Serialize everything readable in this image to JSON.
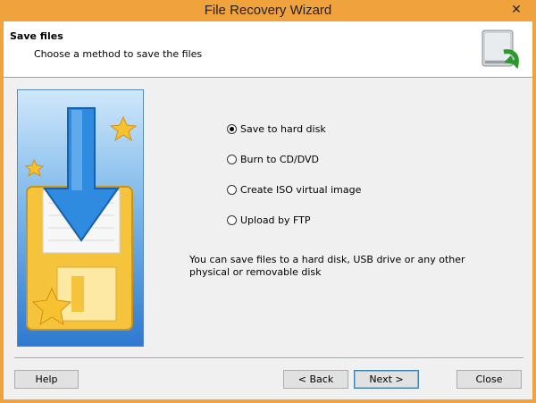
{
  "window": {
    "title": "File Recovery Wizard",
    "close_glyph": "✕"
  },
  "header": {
    "title": "Save files",
    "subtitle": "Choose a method to save the files",
    "icon": "hard-drive-recover-icon"
  },
  "options": [
    {
      "label": "Save to hard disk",
      "checked": true
    },
    {
      "label": "Burn to CD/DVD",
      "checked": false
    },
    {
      "label": "Create ISO virtual image",
      "checked": false
    },
    {
      "label": "Upload by FTP",
      "checked": false
    }
  ],
  "description": "You can save files to a hard disk, USB drive or any other physical or removable disk",
  "buttons": {
    "help": "Help",
    "back": "< Back",
    "next": "Next >",
    "close": "Close"
  },
  "colors": {
    "titlebar": "#f0a23c",
    "default_button_border": "#3c7fb1"
  }
}
